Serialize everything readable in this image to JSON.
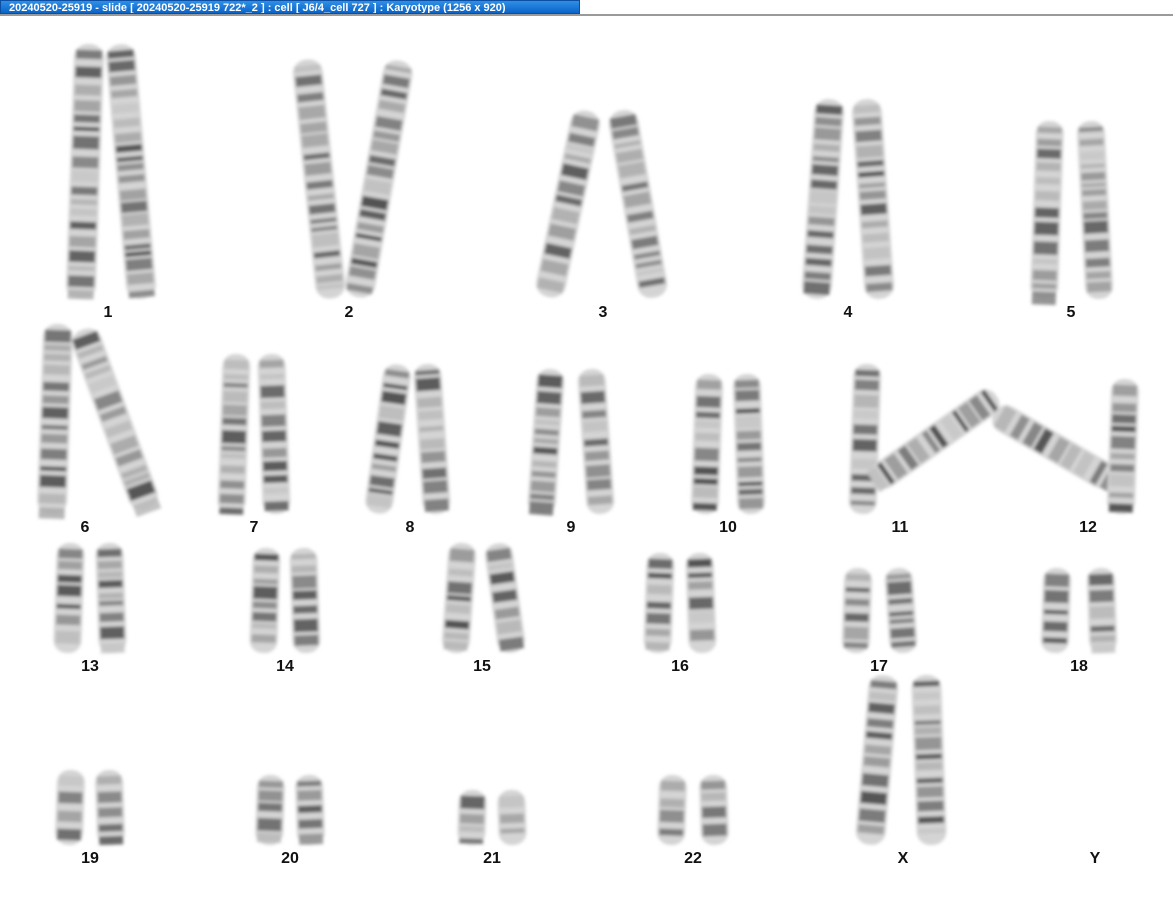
{
  "window": {
    "title": "20240520-25919 - slide [ 20240520-25919 722*_2 ] : cell [ J6/4_cell 727 ] : Karyotype  (1256 x 920)"
  },
  "karyotype": {
    "labels": {
      "c1": "1",
      "c2": "2",
      "c3": "3",
      "c4": "4",
      "c5": "5",
      "c6": "6",
      "c7": "7",
      "c8": "8",
      "c9": "9",
      "c10": "10",
      "c11": "11",
      "c12": "12",
      "c13": "13",
      "c14": "14",
      "c15": "15",
      "c16": "16",
      "c17": "17",
      "c18": "18",
      "c19": "19",
      "c20": "20",
      "c21": "21",
      "c22": "22",
      "cX": "X",
      "cY": "Y"
    }
  }
}
